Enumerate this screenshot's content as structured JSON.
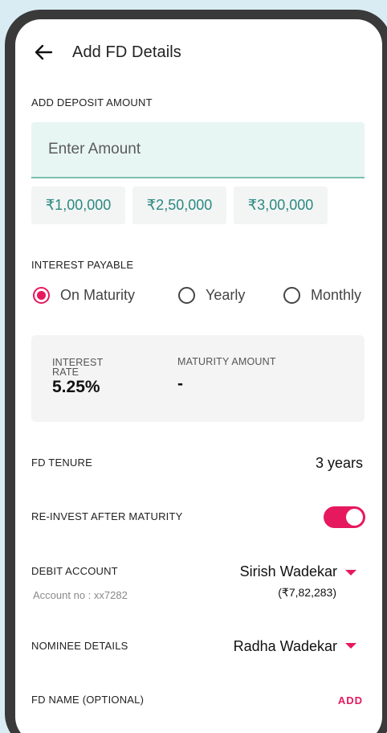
{
  "header": {
    "title": "Add FD Details",
    "back_icon": "arrow-left-icon"
  },
  "deposit": {
    "label": "ADD DEPOSIT AMOUNT",
    "input_placeholder": "Enter Amount",
    "input_value": "",
    "quick_amounts": [
      "₹1,00,000",
      "₹2,50,000",
      "₹3,00,000"
    ]
  },
  "interest_payable": {
    "label": "INTEREST PAYABLE",
    "options": [
      "On Maturity",
      "Yearly",
      "Monthly"
    ],
    "selected": "On Maturity"
  },
  "summary": {
    "rate_label": "INTEREST RATE",
    "rate_label_line1": "INTEREST",
    "rate_label_line2": "RATE",
    "rate_value": "5.25%",
    "maturity_label": "MATURITY AMOUNT",
    "maturity_value": "-"
  },
  "tenure": {
    "label": "FD TENURE",
    "value": "3 years"
  },
  "reinvest": {
    "label": "RE-INVEST AFTER MATURITY",
    "enabled": true
  },
  "debit_account": {
    "label": "DEBIT ACCOUNT",
    "account_no": "Account no : xx7282",
    "name": "Sirish Wadekar",
    "balance": "(₹7,82,283)"
  },
  "nominee": {
    "label": "NOMINEE DETAILS",
    "name": "Radha Wadekar"
  },
  "fd_name": {
    "label": "FD NAME (OPTIONAL)",
    "action": "ADD"
  },
  "colors": {
    "accent": "#e6195e",
    "teal": "#2b8a82",
    "input_bg": "#e8f6f3",
    "background": "#d9ecf3"
  }
}
